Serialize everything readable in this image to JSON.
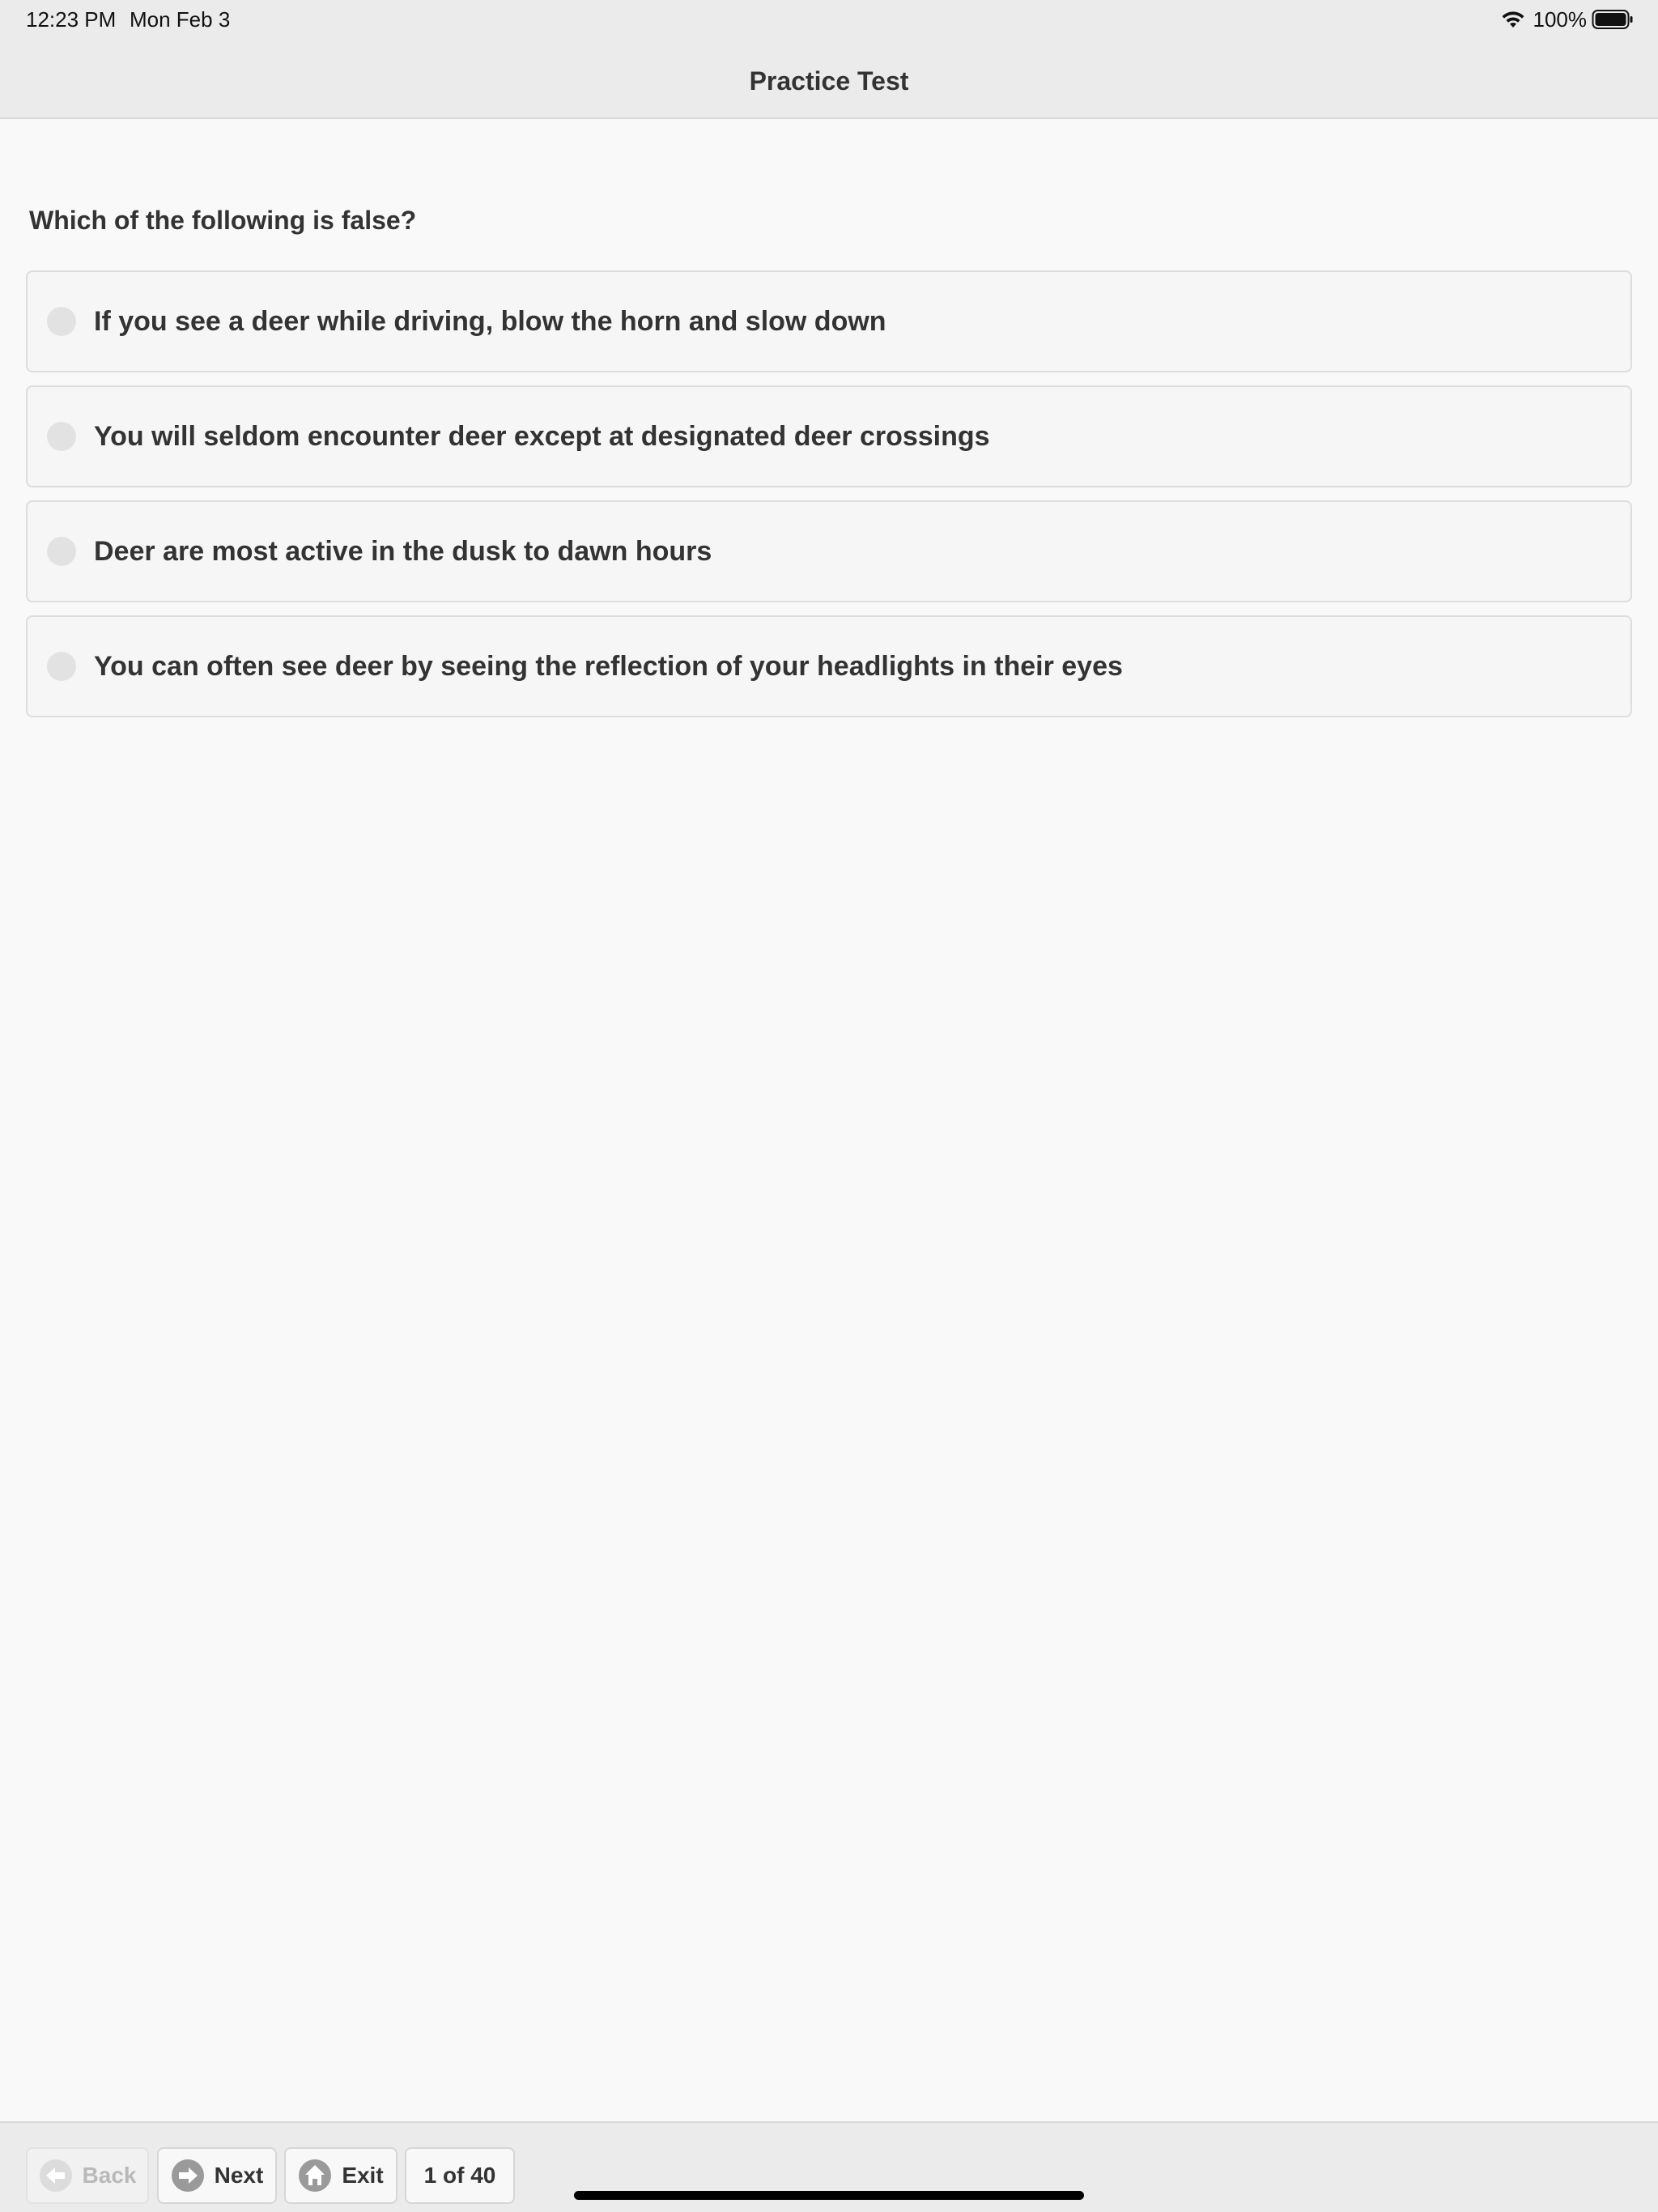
{
  "status_bar": {
    "time": "12:23 PM",
    "date": "Mon Feb 3",
    "battery": "100%"
  },
  "header": {
    "title": "Practice Test"
  },
  "question": {
    "text": "Which of the following is false?",
    "answers": [
      {
        "label": "If you see a deer while driving, blow the horn and slow down",
        "selected": false
      },
      {
        "label": "You will seldom encounter deer except at designated deer crossings",
        "selected": false
      },
      {
        "label": "Deer are most active in the dusk to dawn hours",
        "selected": false
      },
      {
        "label": "You can often see deer by seeing the reflection of your headlights in their eyes",
        "selected": false
      }
    ]
  },
  "toolbar": {
    "back_label": "Back",
    "back_enabled": false,
    "next_label": "Next",
    "exit_label": "Exit",
    "progress_label": "1 of 40"
  },
  "icons": {
    "wifi": "wifi-icon",
    "battery": "battery-icon",
    "back": "arrow-left-circle-icon",
    "next": "arrow-right-circle-icon",
    "exit": "home-circle-icon"
  },
  "colors": {
    "header_bg": "#ebebeb",
    "page_bg": "#f9f9f9",
    "text": "#333333",
    "answer_bg": "#f6f6f6",
    "answer_border": "#dddddd",
    "radio": "#e2e2e2",
    "icon_gray": "#9a9a9a"
  }
}
